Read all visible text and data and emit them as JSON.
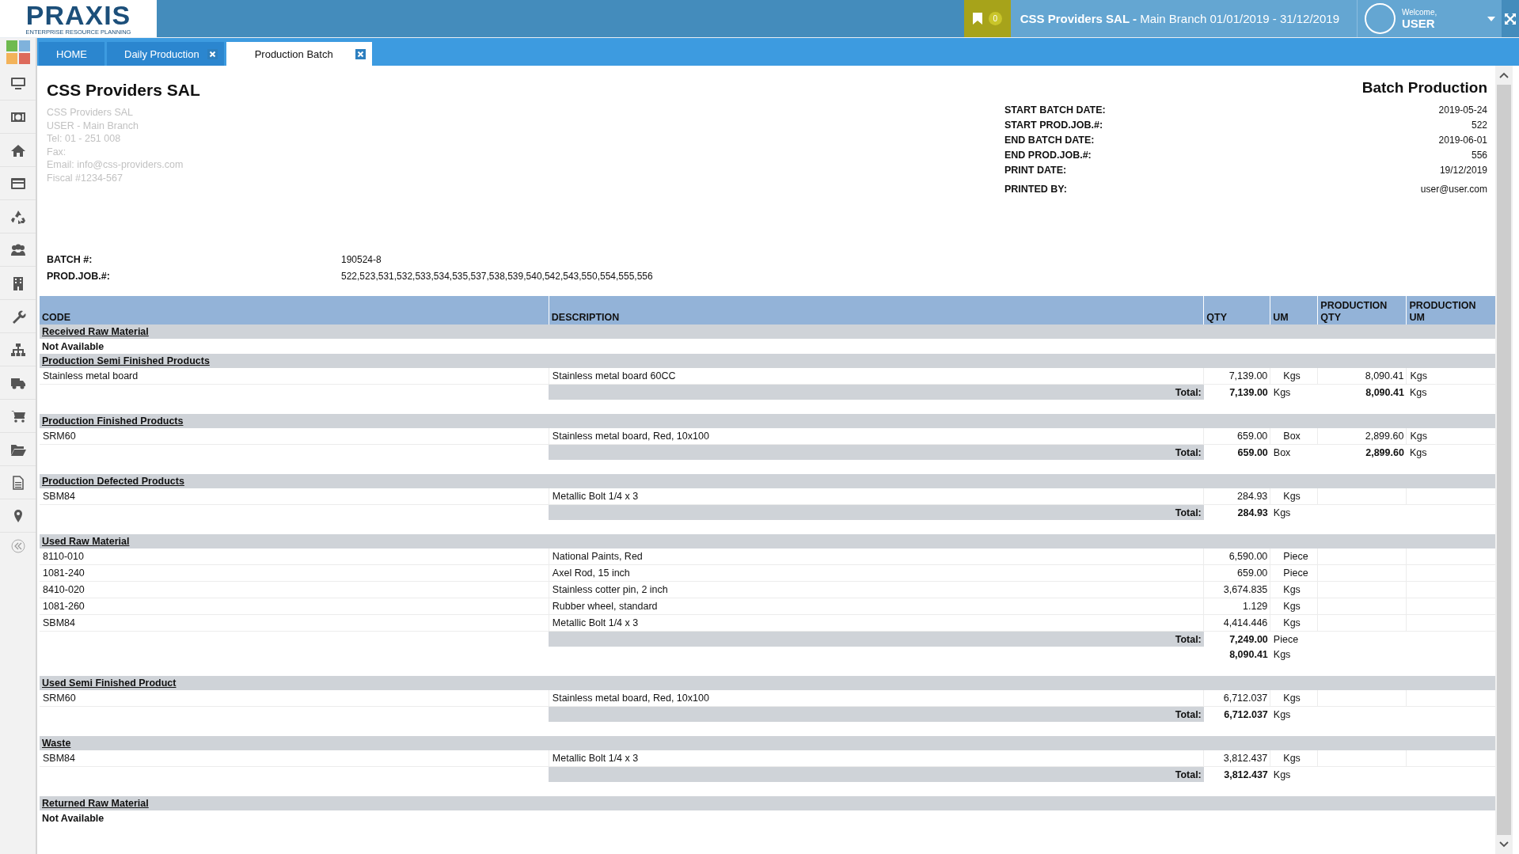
{
  "header": {
    "logo": "PRAXIS",
    "logo_tagline": "ENTERPRISE RESOURCE PLANNING",
    "notifications": "0",
    "context": "**CSS Providers SAL -** Main Branch 01/01/2019 - 31/12/2019",
    "welcome": "Welcome,",
    "user": "USER"
  },
  "tabs": [
    {
      "label": "HOME",
      "selected": false,
      "closable": false
    },
    {
      "label": "Daily Production",
      "selected": false,
      "closable": true
    },
    {
      "label": "Production Batch",
      "selected": true,
      "closable": true
    }
  ],
  "report": {
    "company": "CSS Providers SAL",
    "title": "Batch Production",
    "company_info": [
      "CSS Providers SAL",
      "USER - Main Branch",
      "Tel: 01 - 251 008",
      "Fax:",
      "Email: info@css-providers.com",
      "Fiscal #1234-567"
    ],
    "meta": [
      {
        "label": "START BATCH DATE:",
        "value": "2019-05-24"
      },
      {
        "label": "START PROD.JOB.#:",
        "value": "522"
      },
      {
        "label": "END BATCH DATE:",
        "value": "2019-06-01"
      },
      {
        "label": "END PROD.JOB.#:",
        "value": "556"
      },
      {
        "label": "PRINT DATE:",
        "value": "19/12/2019"
      },
      {
        "label": "PRINTED BY:",
        "value": "user@user.com"
      }
    ],
    "batch": [
      {
        "label": "BATCH #:",
        "value": "190524-8"
      },
      {
        "label": "PROD.JOB.#:",
        "value": "522,523,531,532,533,534,535,537,538,539,540,542,543,550,554,555,556"
      }
    ],
    "columns": [
      "CODE",
      "DESCRIPTION",
      "QTY",
      "UM",
      "PRODUCTION QTY",
      "PRODUCTION UM"
    ],
    "sections": [
      {
        "title": "Received Raw Material",
        "empty": "Not Available"
      },
      {
        "title": "Production Semi Finished Products",
        "rows": [
          {
            "code": "Stainless metal board",
            "description": "Stainless metal board 60CC",
            "qty": "7,139.00",
            "um": "Kgs",
            "prod_qty": "8,090.41",
            "prod_um": "Kgs"
          }
        ],
        "total": {
          "label": "Total:",
          "lines": [
            {
              "qty": "7,139.00",
              "um": "Kgs",
              "prod_qty": "8,090.41",
              "prod_um": "Kgs"
            }
          ]
        }
      },
      {
        "title": "Production Finished Products",
        "rows": [
          {
            "code": "SRM60",
            "description": "Stainless metal board, Red, 10x100",
            "qty": "659.00",
            "um": "Box",
            "prod_qty": "2,899.60",
            "prod_um": "Kgs"
          }
        ],
        "total": {
          "label": "Total:",
          "lines": [
            {
              "qty": "659.00",
              "um": "Box",
              "prod_qty": "2,899.60",
              "prod_um": "Kgs"
            }
          ]
        }
      },
      {
        "title": "Production Defected Products",
        "rows": [
          {
            "code": "SBM84",
            "description": "Metallic Bolt 1/4 x 3",
            "qty": "284.93",
            "um": "Kgs"
          }
        ],
        "total": {
          "label": "Total:",
          "lines": [
            {
              "qty": "284.93",
              "um": "Kgs"
            }
          ]
        }
      },
      {
        "title": "Used Raw Material",
        "rows": [
          {
            "code": "8110-010",
            "description": "National Paints, Red",
            "qty": "6,590.00",
            "um": "Piece"
          },
          {
            "code": "1081-240",
            "description": "Axel Rod, 15 inch",
            "qty": "659.00",
            "um": "Piece"
          },
          {
            "code": "8410-020",
            "description": "Stainless cotter pin, 2 inch",
            "qty": "3,674.835",
            "um": "Kgs"
          },
          {
            "code": "1081-260",
            "description": "Rubber wheel, standard",
            "qty": "1.129",
            "um": "Kgs"
          },
          {
            "code": "SBM84",
            "description": "Metallic Bolt 1/4 x 3",
            "qty": "4,414.446",
            "um": "Kgs"
          }
        ],
        "total": {
          "label": "Total:",
          "lines": [
            {
              "qty": "7,249.00",
              "um": "Piece"
            },
            {
              "qty": "8,090.41",
              "um": "Kgs"
            }
          ]
        }
      },
      {
        "title": "Used Semi Finished Product",
        "rows": [
          {
            "code": "SRM60",
            "description": "Stainless metal board, Red, 10x100",
            "qty": "6,712.037",
            "um": "Kgs"
          }
        ],
        "total": {
          "label": "Total:",
          "lines": [
            {
              "qty": "6,712.037",
              "um": "Kgs"
            }
          ]
        }
      },
      {
        "title": "Waste",
        "rows": [
          {
            "code": "SBM84",
            "description": "Metallic Bolt 1/4 x 3",
            "qty": "3,812.437",
            "um": "Kgs"
          }
        ],
        "total": {
          "label": "Total:",
          "lines": [
            {
              "qty": "3,812.437",
              "um": "Kgs"
            }
          ]
        }
      },
      {
        "title": "Returned Raw Material",
        "empty": "Not Available"
      }
    ]
  }
}
